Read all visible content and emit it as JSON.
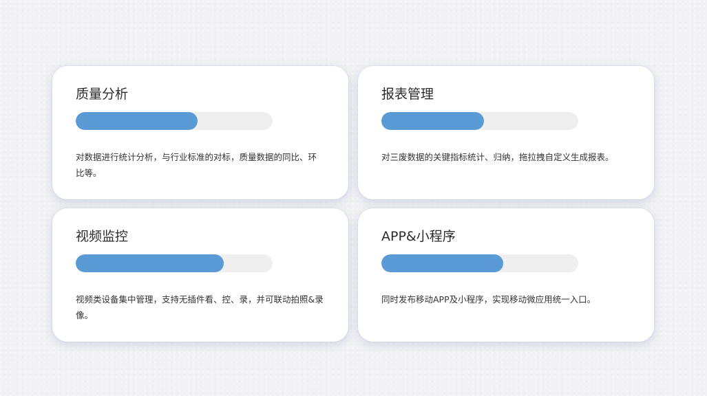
{
  "cards": [
    {
      "title": "质量分析",
      "progress": 0.62,
      "description": "对数据进行统计分析，与行业标准的对标，质量数据的同比、环比等。"
    },
    {
      "title": "报表管理",
      "progress": 0.52,
      "description": "对三废数据的关键指标统计、归纳，拖拉拽自定义生成报表。"
    },
    {
      "title": "视频监控",
      "progress": 0.75,
      "description": "视频类设备集中管理，支持无插件看、控、录，并可联动拍照&录像。"
    },
    {
      "title": "APP&小程序",
      "progress": 0.62,
      "description": "同时发布移动APP及小程序，实现移动微应用统一入口。"
    }
  ],
  "colors": {
    "progress_fill": "#5b9bd5",
    "progress_track": "#efeff0",
    "card_background": "#ffffff",
    "page_background": "#f2f2f4"
  }
}
